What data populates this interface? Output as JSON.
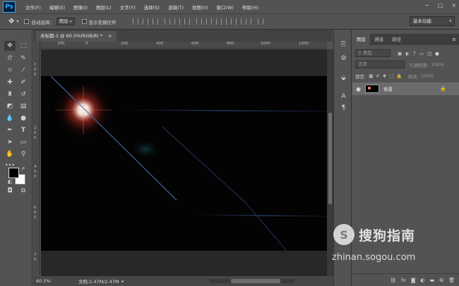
{
  "app": {
    "logo": "Ps"
  },
  "menu": [
    "文件(F)",
    "编辑(E)",
    "图像(I)",
    "图层(L)",
    "文字(Y)",
    "选择(S)",
    "滤镜(T)",
    "视图(V)",
    "窗口(W)",
    "帮助(H)"
  ],
  "window_controls": {
    "minimize": "−",
    "maximize": "□",
    "close": "×"
  },
  "options_bar": {
    "auto_select_label": "自动选择：",
    "auto_select_value": "图层",
    "show_transform_label": "显示变换控件",
    "workspace": "基本功能"
  },
  "document": {
    "tab_title": "未标题-1 @ 60.5%(RGB/8) *",
    "close_glyph": "×"
  },
  "rulers": {
    "top": [
      "200",
      "0",
      "200",
      "400",
      "600",
      "800",
      "1000",
      "1200"
    ],
    "left": [
      "2",
      "0",
      "0",
      "2",
      "0",
      "0",
      "4",
      "0",
      "0",
      "6",
      "0",
      "0",
      "7",
      "0"
    ]
  },
  "status": {
    "zoom": "60.5%",
    "doc_info": "文档:2.47M/2.47M"
  },
  "layers_panel": {
    "tabs": [
      "图层",
      "通道",
      "路径"
    ],
    "active_tab": "图层",
    "search_placeholder": "类型",
    "blend_mode": "正常",
    "opacity_label": "不透明度:",
    "opacity_value": "100%",
    "lock_label": "锁定:",
    "fill_label": "填充:",
    "fill_value": "100%",
    "layer_name": "背景"
  },
  "watermark": {
    "brand": "搜狗指南",
    "url": "zhinan.sogou.com",
    "logo_letter": "S"
  },
  "colors": {
    "bg": "#535353",
    "canvas": "#030303",
    "flare_core": "#ffffff",
    "flare_glow": "#d23a2a",
    "streak": "#3a5a9a"
  }
}
